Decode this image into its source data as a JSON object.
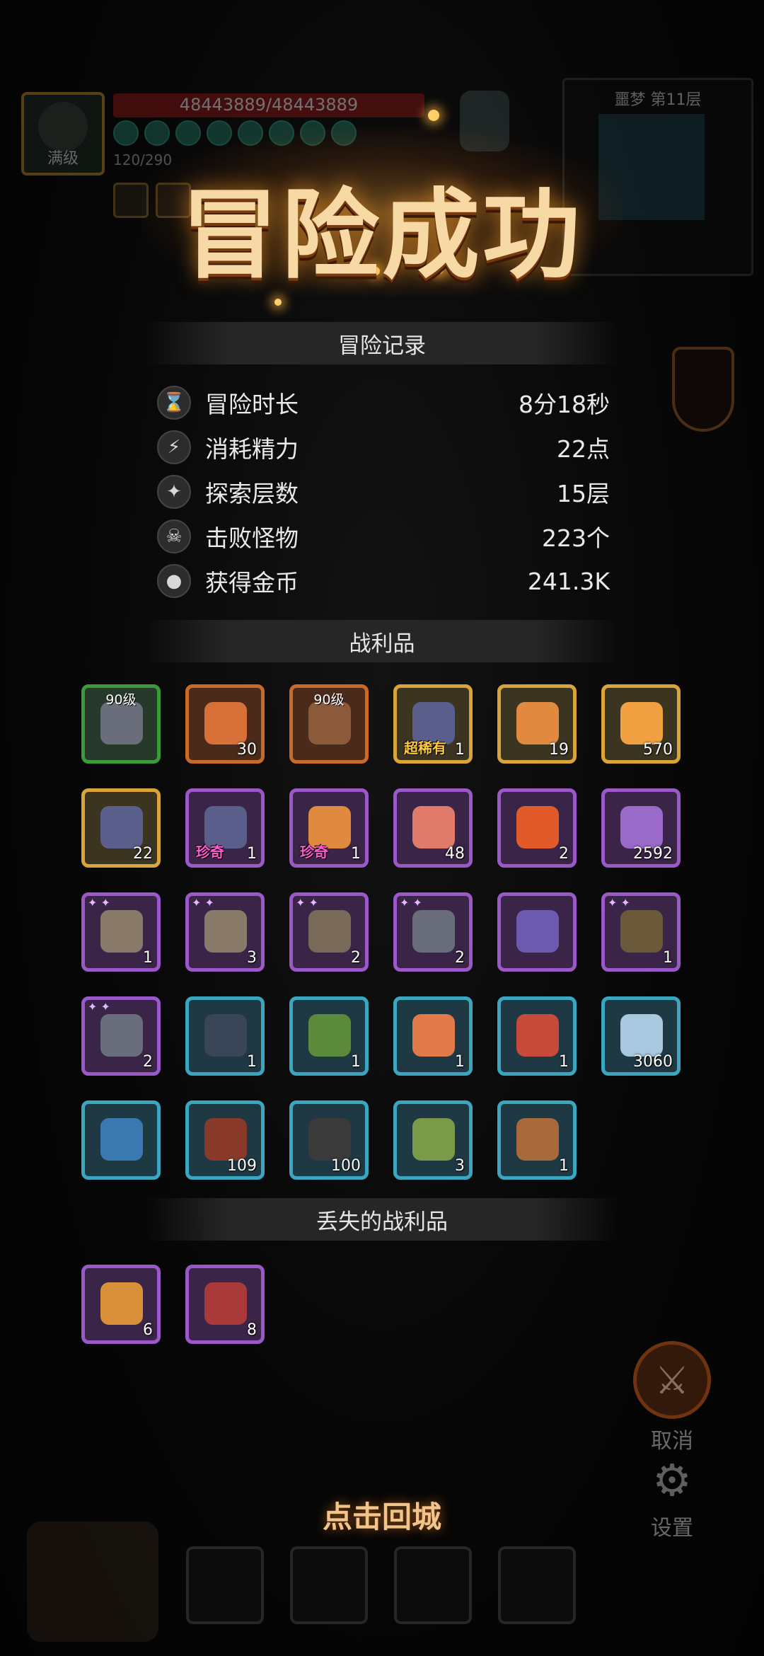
{
  "hud": {
    "level_label": "满级",
    "hp_text": "48443889/48443889",
    "energy_text": "120/290",
    "minimap_title": "噩梦 第11层"
  },
  "title": "冒险成功",
  "record": {
    "header": "冒险记录",
    "rows": [
      {
        "icon": "hourglass-icon",
        "glyph": "⌛",
        "label": "冒险时长",
        "value": "8分18秒"
      },
      {
        "icon": "lightning-icon",
        "glyph": "⚡",
        "label": "消耗精力",
        "value": "22点"
      },
      {
        "icon": "floor-icon",
        "glyph": "✦",
        "label": "探索层数",
        "value": "15层"
      },
      {
        "icon": "skull-icon",
        "glyph": "☠",
        "label": "击败怪物",
        "value": "223个"
      },
      {
        "icon": "coin-icon",
        "glyph": "●",
        "label": "获得金币",
        "value": "241.3K"
      }
    ]
  },
  "loot": {
    "header": "战利品",
    "items": [
      {
        "rarity": "green",
        "art": "#6a6e7a",
        "level": "90级",
        "count": ""
      },
      {
        "rarity": "orange",
        "art": "#d8703a",
        "count": "30"
      },
      {
        "rarity": "orange",
        "art": "#8a5a3a",
        "level": "90级",
        "count": ""
      },
      {
        "rarity": "gold",
        "art": "#5a5e8a",
        "tag": "超稀有",
        "tag_color": "gold",
        "count": "1"
      },
      {
        "rarity": "gold",
        "art": "#e08a40",
        "count": "19"
      },
      {
        "rarity": "gold",
        "art": "#f0a040",
        "count": "570"
      },
      {
        "rarity": "gold",
        "art": "#5a5e8a",
        "count": "22"
      },
      {
        "rarity": "purple",
        "art": "#5a5e8a",
        "tag": "珍奇",
        "tag_color": "pink",
        "count": "1"
      },
      {
        "rarity": "purple",
        "art": "#e08a40",
        "tag": "珍奇",
        "tag_color": "pink",
        "count": "1"
      },
      {
        "rarity": "purple",
        "art": "#e07a6a",
        "count": "48"
      },
      {
        "rarity": "purple",
        "art": "#e05a2a",
        "count": "2"
      },
      {
        "rarity": "purple",
        "art": "#9a6ac8",
        "count": "2592"
      },
      {
        "rarity": "purple",
        "art": "#8a7a6a",
        "stars": true,
        "count": "1"
      },
      {
        "rarity": "purple",
        "art": "#8a7a6a",
        "stars": true,
        "count": "3"
      },
      {
        "rarity": "purple",
        "art": "#7a6a5a",
        "stars": true,
        "count": "2"
      },
      {
        "rarity": "purple",
        "art": "#6a6e7a",
        "stars": true,
        "count": "2"
      },
      {
        "rarity": "purple",
        "art": "#6a5ab0",
        "count": ""
      },
      {
        "rarity": "purple",
        "art": "#6a5a3a",
        "stars": true,
        "count": "1"
      },
      {
        "rarity": "purple",
        "art": "#6a6e7a",
        "stars": true,
        "count": "2"
      },
      {
        "rarity": "cyan",
        "art": "#3a4658",
        "count": "1"
      },
      {
        "rarity": "cyan",
        "art": "#5a8a3a",
        "count": "1"
      },
      {
        "rarity": "cyan",
        "art": "#e07a4a",
        "count": "1"
      },
      {
        "rarity": "cyan",
        "art": "#c84a3a",
        "count": "1"
      },
      {
        "rarity": "cyan",
        "art": "#a8c8e0",
        "count": "3060"
      },
      {
        "rarity": "cyan",
        "art": "#3a7ab0",
        "count": ""
      },
      {
        "rarity": "cyan",
        "art": "#8a3a2a",
        "count": "109"
      },
      {
        "rarity": "cyan",
        "art": "#3a3a3a",
        "count": "100"
      },
      {
        "rarity": "cyan",
        "art": "#7a9a4a",
        "count": "3"
      },
      {
        "rarity": "cyan",
        "art": "#a86a3a",
        "count": "1"
      }
    ]
  },
  "lost_loot": {
    "header": "丢失的战利品",
    "items": [
      {
        "rarity": "purple",
        "art": "#d8903a",
        "count": "6"
      },
      {
        "rarity": "purple",
        "art": "#a83a3a",
        "count": "8"
      }
    ]
  },
  "side": {
    "cancel_label": "取消",
    "settings_label": "设置"
  },
  "back_to_town": "点击回城"
}
